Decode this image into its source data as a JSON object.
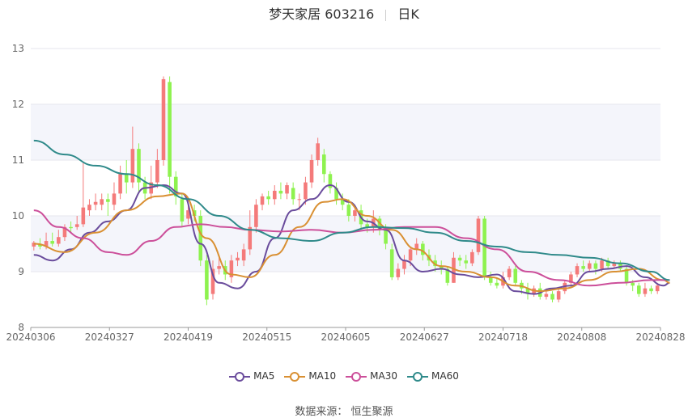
{
  "title": {
    "name": "梦天家居 603216",
    "period": "日K"
  },
  "source": "数据来源： 恒生聚源",
  "chart_data": {
    "type": "candlestick",
    "y_ticks": [
      8,
      9,
      10,
      11,
      12,
      13
    ],
    "ylim": [
      8,
      13
    ],
    "x_ticks": [
      "20240306",
      "20240327",
      "20240419",
      "20240515",
      "20240605",
      "20240627",
      "20240718",
      "20240808",
      "20240828"
    ],
    "grid": "horizontal-bands",
    "legend_position": "bottom",
    "up_color": "#f47a7a",
    "down_color": "#8ef24f",
    "candles": [
      [
        9.45,
        9.52,
        9.38,
        9.55
      ],
      [
        9.5,
        9.45,
        9.4,
        9.6
      ],
      [
        9.45,
        9.55,
        9.4,
        9.7
      ],
      [
        9.55,
        9.5,
        9.45,
        9.7
      ],
      [
        9.5,
        9.62,
        9.45,
        9.75
      ],
      [
        9.62,
        9.8,
        9.55,
        9.85
      ],
      [
        9.8,
        9.78,
        9.7,
        9.9
      ],
      [
        9.8,
        9.85,
        9.75,
        10.0
      ],
      [
        9.85,
        10.15,
        9.8,
        10.95
      ],
      [
        10.1,
        10.2,
        10.0,
        10.3
      ],
      [
        10.2,
        10.25,
        10.1,
        10.4
      ],
      [
        10.2,
        10.3,
        10.1,
        10.4
      ],
      [
        10.3,
        10.25,
        10.0,
        10.4
      ],
      [
        10.2,
        10.4,
        10.1,
        10.6
      ],
      [
        10.4,
        10.75,
        10.3,
        10.9
      ],
      [
        10.75,
        10.6,
        10.4,
        11.0
      ],
      [
        10.6,
        11.2,
        10.5,
        11.6
      ],
      [
        11.2,
        10.6,
        10.4,
        11.3
      ],
      [
        10.6,
        10.4,
        10.3,
        10.7
      ],
      [
        10.4,
        10.6,
        10.3,
        10.9
      ],
      [
        10.6,
        11.0,
        10.5,
        11.2
      ],
      [
        11.0,
        12.45,
        10.9,
        12.5
      ],
      [
        12.4,
        10.7,
        10.4,
        12.5
      ],
      [
        10.7,
        10.35,
        10.2,
        10.8
      ],
      [
        10.3,
        9.9,
        9.8,
        10.4
      ],
      [
        9.95,
        10.1,
        9.85,
        10.3
      ],
      [
        10.1,
        10.0,
        9.9,
        10.2
      ],
      [
        10.0,
        9.2,
        9.1,
        10.1
      ],
      [
        9.2,
        8.5,
        8.4,
        9.3
      ],
      [
        8.6,
        9.05,
        8.5,
        9.2
      ],
      [
        9.05,
        9.1,
        8.95,
        9.3
      ],
      [
        9.1,
        8.95,
        8.85,
        9.2
      ],
      [
        8.9,
        9.2,
        8.8,
        9.3
      ],
      [
        9.2,
        9.25,
        9.1,
        9.35
      ],
      [
        9.2,
        9.4,
        9.1,
        9.5
      ],
      [
        9.4,
        9.8,
        9.3,
        10.1
      ],
      [
        9.8,
        10.2,
        9.7,
        10.3
      ],
      [
        10.2,
        10.35,
        10.1,
        10.4
      ],
      [
        10.35,
        10.3,
        10.2,
        10.45
      ],
      [
        10.3,
        10.45,
        10.2,
        10.55
      ],
      [
        10.45,
        10.4,
        10.3,
        10.6
      ],
      [
        10.4,
        10.55,
        10.3,
        10.6
      ],
      [
        10.5,
        10.3,
        10.2,
        10.6
      ],
      [
        10.3,
        10.3,
        10.1,
        10.4
      ],
      [
        10.3,
        10.6,
        10.2,
        10.7
      ],
      [
        10.6,
        11.0,
        10.5,
        11.1
      ],
      [
        11.0,
        11.3,
        10.9,
        11.4
      ],
      [
        11.1,
        10.75,
        10.6,
        11.2
      ],
      [
        10.75,
        10.5,
        10.4,
        10.8
      ],
      [
        10.5,
        10.3,
        10.2,
        10.6
      ],
      [
        10.3,
        10.2,
        10.1,
        10.4
      ],
      [
        10.2,
        10.0,
        9.9,
        10.3
      ],
      [
        10.0,
        10.1,
        9.9,
        10.2
      ],
      [
        10.1,
        9.85,
        9.75,
        10.2
      ],
      [
        9.85,
        9.8,
        9.7,
        9.95
      ],
      [
        9.8,
        9.95,
        9.7,
        10.1
      ],
      [
        9.95,
        9.75,
        9.65,
        10.0
      ],
      [
        9.75,
        9.5,
        9.4,
        9.85
      ],
      [
        9.4,
        8.9,
        8.85,
        9.5
      ],
      [
        8.9,
        9.05,
        8.85,
        9.15
      ],
      [
        9.05,
        9.2,
        8.95,
        9.3
      ],
      [
        9.2,
        9.4,
        9.1,
        9.45
      ],
      [
        9.4,
        9.5,
        9.3,
        9.6
      ],
      [
        9.5,
        9.3,
        9.2,
        9.55
      ],
      [
        9.3,
        9.2,
        9.1,
        9.4
      ],
      [
        9.2,
        9.1,
        9.0,
        9.3
      ],
      [
        9.1,
        9.05,
        8.95,
        9.2
      ],
      [
        9.05,
        8.8,
        8.75,
        9.1
      ],
      [
        8.8,
        9.25,
        8.8,
        9.35
      ],
      [
        9.25,
        9.2,
        9.1,
        9.3
      ],
      [
        9.2,
        9.15,
        9.05,
        9.3
      ],
      [
        9.15,
        9.35,
        9.1,
        9.4
      ],
      [
        9.35,
        9.95,
        9.3,
        10.0
      ],
      [
        9.95,
        8.9,
        8.85,
        10.0
      ],
      [
        8.9,
        8.8,
        8.75,
        9.0
      ],
      [
        8.8,
        8.75,
        8.7,
        8.9
      ],
      [
        8.75,
        8.9,
        8.7,
        9.0
      ],
      [
        8.9,
        9.05,
        8.85,
        9.1
      ],
      [
        9.05,
        8.8,
        8.75,
        9.1
      ],
      [
        8.8,
        8.7,
        8.6,
        8.85
      ],
      [
        8.7,
        8.6,
        8.5,
        8.8
      ],
      [
        8.6,
        8.7,
        8.55,
        8.75
      ],
      [
        8.7,
        8.55,
        8.5,
        8.8
      ],
      [
        8.55,
        8.6,
        8.5,
        8.7
      ],
      [
        8.6,
        8.5,
        8.45,
        8.65
      ],
      [
        8.5,
        8.65,
        8.45,
        8.7
      ],
      [
        8.65,
        8.8,
        8.6,
        8.85
      ],
      [
        8.8,
        8.95,
        8.75,
        9.0
      ],
      [
        8.95,
        9.1,
        8.9,
        9.15
      ],
      [
        9.1,
        9.05,
        9.0,
        9.2
      ],
      [
        9.05,
        9.15,
        9.0,
        9.2
      ],
      [
        9.15,
        9.05,
        8.95,
        9.2
      ],
      [
        9.05,
        9.2,
        9.0,
        9.25
      ],
      [
        9.2,
        9.1,
        9.05,
        9.25
      ],
      [
        9.1,
        9.15,
        9.05,
        9.2
      ],
      [
        9.15,
        9.05,
        9.0,
        9.2
      ],
      [
        9.05,
        8.8,
        8.75,
        9.1
      ],
      [
        8.8,
        8.75,
        8.65,
        8.85
      ],
      [
        8.75,
        8.6,
        8.55,
        8.8
      ],
      [
        8.6,
        8.7,
        8.55,
        8.8
      ],
      [
        8.7,
        8.65,
        8.6,
        8.75
      ],
      [
        8.65,
        8.75,
        8.6,
        8.8
      ]
    ],
    "series": [
      {
        "name": "MA5",
        "color": "#6a4c9c",
        "values": [
          [
            0,
            9.3
          ],
          [
            3,
            9.2
          ],
          [
            6,
            9.4
          ],
          [
            9,
            9.7
          ],
          [
            12,
            9.9
          ],
          [
            15,
            10.1
          ],
          [
            18,
            10.5
          ],
          [
            21,
            10.55
          ],
          [
            24,
            10.4
          ],
          [
            27,
            9.5
          ],
          [
            30,
            8.8
          ],
          [
            33,
            8.7
          ],
          [
            36,
            9.0
          ],
          [
            39,
            9.6
          ],
          [
            42,
            10.1
          ],
          [
            45,
            10.3
          ],
          [
            48,
            10.55
          ],
          [
            51,
            10.25
          ],
          [
            54,
            9.9
          ],
          [
            57,
            9.75
          ],
          [
            60,
            9.2
          ],
          [
            63,
            9.0
          ],
          [
            66,
            9.05
          ],
          [
            69,
            8.95
          ],
          [
            72,
            8.9
          ],
          [
            75,
            8.95
          ],
          [
            78,
            8.65
          ],
          [
            81,
            8.6
          ],
          [
            84,
            8.7
          ],
          [
            87,
            8.75
          ],
          [
            90,
            9.0
          ],
          [
            93,
            9.05
          ],
          [
            96,
            9.1
          ],
          [
            99,
            8.9
          ],
          [
            102,
            8.75
          ],
          [
            103,
            8.8
          ]
        ]
      },
      {
        "name": "MA10",
        "color": "#d99033",
        "values": [
          [
            0,
            9.5
          ],
          [
            5,
            9.35
          ],
          [
            10,
            9.7
          ],
          [
            15,
            10.1
          ],
          [
            20,
            10.35
          ],
          [
            24,
            10.4
          ],
          [
            28,
            9.6
          ],
          [
            32,
            8.95
          ],
          [
            35,
            8.9
          ],
          [
            39,
            9.3
          ],
          [
            43,
            9.8
          ],
          [
            47,
            10.25
          ],
          [
            50,
            10.3
          ],
          [
            54,
            10.0
          ],
          [
            58,
            9.75
          ],
          [
            62,
            9.4
          ],
          [
            66,
            9.1
          ],
          [
            70,
            9.0
          ],
          [
            74,
            8.9
          ],
          [
            78,
            8.75
          ],
          [
            82,
            8.65
          ],
          [
            86,
            8.7
          ],
          [
            90,
            8.85
          ],
          [
            94,
            9.0
          ],
          [
            98,
            9.05
          ],
          [
            102,
            8.85
          ],
          [
            103,
            8.8
          ]
        ]
      },
      {
        "name": "MA30",
        "color": "#cc4f9a",
        "values": [
          [
            0,
            10.1
          ],
          [
            4,
            9.8
          ],
          [
            8,
            9.6
          ],
          [
            12,
            9.35
          ],
          [
            15,
            9.3
          ],
          [
            19,
            9.55
          ],
          [
            23,
            9.8
          ],
          [
            27,
            9.85
          ],
          [
            31,
            9.8
          ],
          [
            35,
            9.75
          ],
          [
            40,
            9.72
          ],
          [
            45,
            9.75
          ],
          [
            50,
            9.7
          ],
          [
            55,
            9.75
          ],
          [
            60,
            9.8
          ],
          [
            65,
            9.8
          ],
          [
            70,
            9.6
          ],
          [
            75,
            9.4
          ],
          [
            80,
            9.0
          ],
          [
            85,
            8.85
          ],
          [
            90,
            8.75
          ],
          [
            95,
            8.8
          ],
          [
            100,
            8.85
          ],
          [
            103,
            8.85
          ]
        ]
      },
      {
        "name": "MA60",
        "color": "#2f8a8a",
        "values": [
          [
            0,
            11.35
          ],
          [
            5,
            11.1
          ],
          [
            10,
            10.9
          ],
          [
            15,
            10.75
          ],
          [
            20,
            10.55
          ],
          [
            25,
            10.3
          ],
          [
            30,
            10.0
          ],
          [
            35,
            9.75
          ],
          [
            40,
            9.6
          ],
          [
            45,
            9.55
          ],
          [
            50,
            9.7
          ],
          [
            55,
            9.8
          ],
          [
            60,
            9.78
          ],
          [
            65,
            9.7
          ],
          [
            70,
            9.55
          ],
          [
            75,
            9.45
          ],
          [
            80,
            9.35
          ],
          [
            85,
            9.3
          ],
          [
            90,
            9.25
          ],
          [
            95,
            9.15
          ],
          [
            100,
            9.0
          ],
          [
            103,
            8.85
          ]
        ]
      }
    ]
  }
}
